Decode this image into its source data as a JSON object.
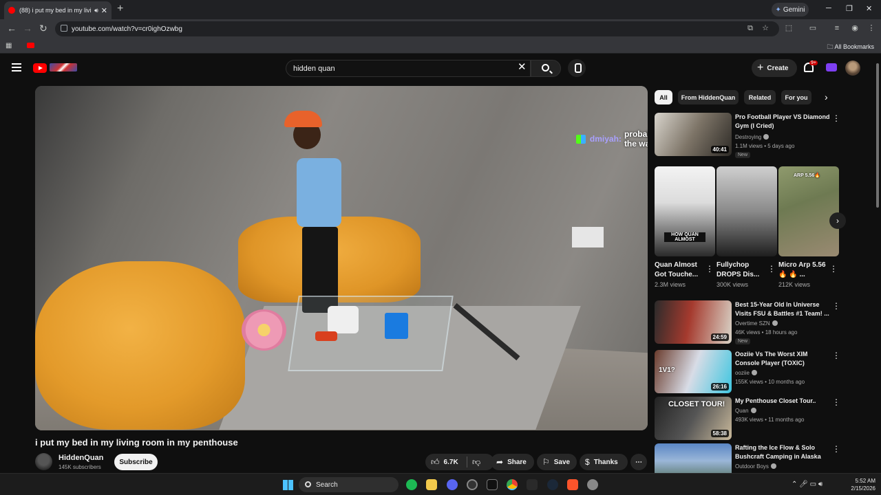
{
  "browser": {
    "tab_title": "(88) i put my bed in my livi",
    "url": "youtube.com/watch?v=cr0ighOzwbg",
    "gemini_label": "Gemini",
    "all_bookmarks": "All Bookmarks"
  },
  "masthead": {
    "search_value": "hidden quan",
    "create_label": "Create",
    "notif_badge": "9+"
  },
  "video": {
    "title": "i put my bed in my living room in my penthouse",
    "overlay_user": "dmiyah:",
    "overlay_msg": "probably the walls",
    "channel": "HiddenQuan",
    "subscribers": "145K subscribers",
    "subscribe_label": "Subscribe",
    "likes": "6.7K",
    "share_label": "Share",
    "save_label": "Save",
    "thanks_label": "Thanks"
  },
  "chips": [
    "All",
    "From HiddenQuan",
    "Related",
    "For you"
  ],
  "recs_top": {
    "title": "Pro Football Player VS Diamond Gym (I Cried)",
    "channel": "Destroying",
    "meta": "1.1M views • 5 days ago",
    "badge": "New",
    "duration": "40:41"
  },
  "shorts": [
    {
      "title": "Quan Almost Got Touche...",
      "views": "2.3M views",
      "thumb_text": "HOW QUAN ALMOST"
    },
    {
      "title": "Fullychop DROPS Dis...",
      "views": "300K views"
    },
    {
      "title": "Micro Arp 5.56 🔥 🔥 ...",
      "views": "212K views",
      "thumb_text": "ARP 5.56🔥"
    }
  ],
  "recs": [
    {
      "title": "Best 15-Year Old In Universe Visits FSU & Battles #1 Team! ...",
      "channel": "Overtime SZN",
      "meta": "46K views • 18 hours ago",
      "badge": "New",
      "duration": "24:59"
    },
    {
      "title": "Ooziie Vs The Worst XIM Console Player (TOXIC)",
      "channel": "ooziie",
      "meta": "155K views • 10 months ago",
      "duration": "26:16",
      "thumb_text": "1V1?"
    },
    {
      "title": "My Penthouse Closet Tour..",
      "channel": "Quan",
      "meta": "493K views • 11 months ago",
      "duration": "58:38",
      "thumb_text": "CLOSET TOUR!"
    },
    {
      "title": "Rafting the Ice Flow & Solo Bushcraft Camping in Alaska",
      "channel": "Outdoor Boys"
    }
  ],
  "taskbar": {
    "search_label": "Search",
    "time": "5:52 AM",
    "date": "2/15/2026"
  }
}
